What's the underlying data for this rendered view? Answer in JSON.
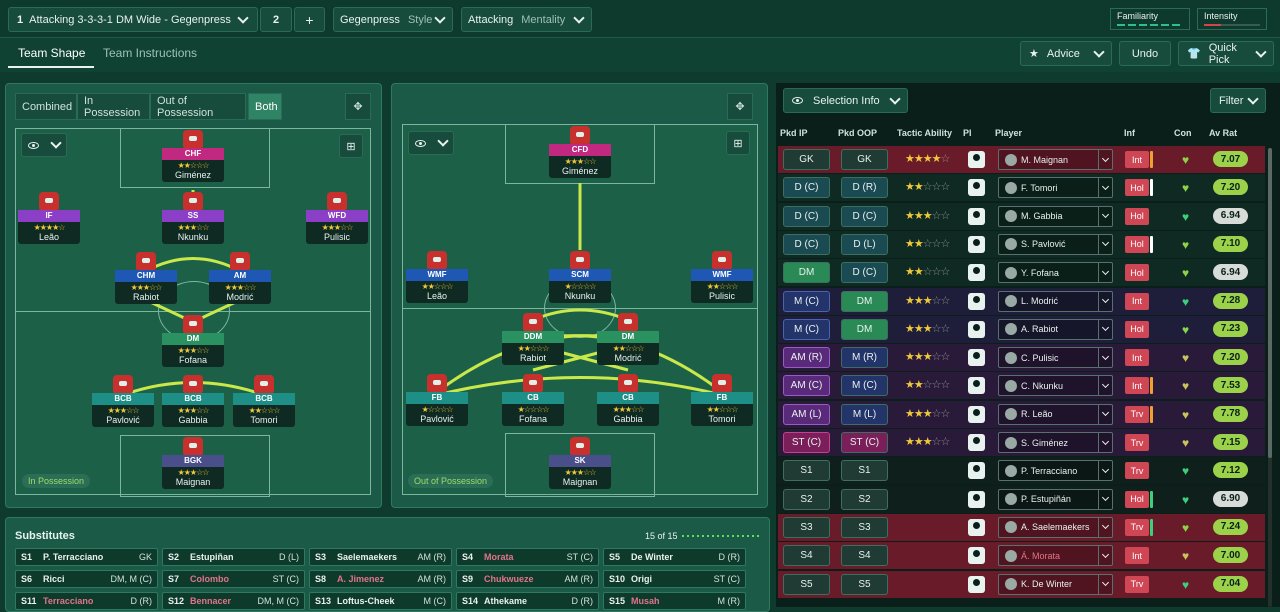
{
  "tactic": {
    "number": "1",
    "name": "Attacking 3-3-3-1 DM Wide - Gegenpress",
    "slot": "2",
    "add": "+",
    "style_value": "Gegenpress",
    "style_label": "Style",
    "mentality_value": "Attacking",
    "mentality_label": "Mentality",
    "familiarity": "Familiarity",
    "intensity": "Intensity"
  },
  "tabs": {
    "team_shape": "Team Shape",
    "team_instructions": "Team Instructions"
  },
  "actions": {
    "advice": "Advice",
    "undo": "Undo",
    "quick_pick": "Quick Pick"
  },
  "views": [
    "Combined",
    "In Possession",
    "Out of Possession",
    "Both"
  ],
  "ip_label": "In Possession",
  "oop_label": "Out of Possession",
  "ip_players": [
    {
      "role": "CHF",
      "name": "Giménez",
      "stars": "★★☆☆☆"
    },
    {
      "role": "IF",
      "name": "Leão",
      "stars": "★★★★☆"
    },
    {
      "role": "SS",
      "name": "Nkunku",
      "stars": "★★★☆☆"
    },
    {
      "role": "WFD",
      "name": "Pulisic",
      "stars": "★★★☆☆"
    },
    {
      "role": "CHM",
      "name": "Rabiot",
      "stars": "★★★☆☆"
    },
    {
      "role": "AM",
      "name": "Modrić",
      "stars": "★★★☆☆"
    },
    {
      "role": "DM",
      "name": "Fofana",
      "stars": "★★★☆☆"
    },
    {
      "role": "BCB",
      "name": "Pavlović",
      "stars": "★★★☆☆"
    },
    {
      "role": "BCB",
      "name": "Gabbia",
      "stars": "★★★☆☆"
    },
    {
      "role": "BCB",
      "name": "Tomori",
      "stars": "★★☆☆☆"
    },
    {
      "role": "BGK",
      "name": "Maignan",
      "stars": "★★★☆☆"
    }
  ],
  "oop_players": [
    {
      "role": "CFD",
      "name": "Giménez",
      "stars": "★★★☆☆"
    },
    {
      "role": "WMF",
      "name": "Leão",
      "stars": "★★☆☆☆"
    },
    {
      "role": "SCM",
      "name": "Nkunku",
      "stars": "★☆☆☆☆"
    },
    {
      "role": "WMF",
      "name": "Pulisic",
      "stars": "★★☆☆☆"
    },
    {
      "role": "DDM",
      "name": "Rabiot",
      "stars": "★★☆☆☆"
    },
    {
      "role": "DM",
      "name": "Modrić",
      "stars": "★★☆☆☆"
    },
    {
      "role": "FB",
      "name": "Pavlović",
      "stars": "★☆☆☆☆"
    },
    {
      "role": "CB",
      "name": "Fofana",
      "stars": "★☆☆☆☆"
    },
    {
      "role": "CB",
      "name": "Gabbia",
      "stars": "★★★☆☆"
    },
    {
      "role": "FB",
      "name": "Tomori",
      "stars": "★★☆☆☆"
    },
    {
      "role": "SK",
      "name": "Maignan",
      "stars": "★★★☆☆"
    }
  ],
  "subs": {
    "title": "Substitutes",
    "count": "15 of 15",
    "rows": [
      [
        {
          "k": "S1",
          "n": "P. Terracciano",
          "p": "GK"
        },
        {
          "k": "S2",
          "n": "Estupiñan",
          "p": "D (L)"
        },
        {
          "k": "S3",
          "n": "Saelemaekers",
          "p": "AM (R)"
        },
        {
          "k": "S4",
          "n": "Morata",
          "p": "ST (C)",
          "red": true
        },
        {
          "k": "S5",
          "n": "De Winter",
          "p": "D (R)"
        }
      ],
      [
        {
          "k": "S6",
          "n": "Ricci",
          "p": "DM, M (C)"
        },
        {
          "k": "S7",
          "n": "Colombo",
          "p": "ST (C)",
          "red": true
        },
        {
          "k": "S8",
          "n": "A. Jimenez",
          "p": "AM (R)",
          "red": true
        },
        {
          "k": "S9",
          "n": "Chukwueze",
          "p": "AM (R)",
          "red": true
        },
        {
          "k": "S10",
          "n": "Origi",
          "p": "ST (C)"
        }
      ],
      [
        {
          "k": "S11",
          "n": "Terracciano",
          "p": "D (R)",
          "red": true
        },
        {
          "k": "S12",
          "n": "Bennacer",
          "p": "DM, M (C)",
          "red": true
        },
        {
          "k": "S13",
          "n": "Loftus-Cheek",
          "p": "M (C)"
        },
        {
          "k": "S14",
          "n": "Athekame",
          "p": "D (R)"
        },
        {
          "k": "S15",
          "n": "Musah",
          "p": "M (R)",
          "red": true
        }
      ]
    ]
  },
  "selection": {
    "label": "Selection Info",
    "filter": "Filter"
  },
  "headers": {
    "ip": "Pkd IP",
    "oop": "Pkd OOP",
    "ta": "Tactic Ability",
    "pi": "PI",
    "player": "Player",
    "inf": "Inf",
    "con": "Con",
    "avrat": "Av Rat"
  },
  "rows": [
    {
      "ip": "GK",
      "oop": "GK",
      "s": 3.5,
      "player": "M. Maignan",
      "inf": "Int",
      "rat": "7.07",
      "infbar": "#f0a030",
      "heart": "#8bd44a",
      "ratc": "#9bd24a"
    },
    {
      "ip": "D (C)",
      "oop": "D (R)",
      "s": 2,
      "player": "F. Tomori",
      "inf": "Hol",
      "rat": "7.20",
      "infbar": "#ffffff",
      "heart": "#8bd44a",
      "ratc": "#9bd24a"
    },
    {
      "ip": "D (C)",
      "oop": "D (C)",
      "s": 3,
      "player": "M. Gabbia",
      "inf": "Hol",
      "rat": "6.94",
      "infbar": "",
      "heart": "#3cd07c",
      "ratc": "#d8dcd8"
    },
    {
      "ip": "D (C)",
      "oop": "D (L)",
      "s": 2,
      "player": "S. Pavlović",
      "inf": "Hol",
      "rat": "7.10",
      "infbar": "#ffffff",
      "heart": "#8bd44a",
      "ratc": "#9bd24a"
    },
    {
      "ip": "DM",
      "oop": "D (C)",
      "s": 2,
      "player": "Y. Fofana",
      "inf": "Hol",
      "rat": "6.94",
      "infbar": "",
      "heart": "#8bd44a",
      "ratc": "#d8dcd8"
    },
    {
      "ip": "M (C)",
      "oop": "DM",
      "s": 3,
      "player": "L. Modrić",
      "inf": "Int",
      "rat": "7.28",
      "infbar": "",
      "heart": "#3cd07c",
      "ratc": "#9bd24a"
    },
    {
      "ip": "M (C)",
      "oop": "DM",
      "s": 3,
      "player": "A. Rabiot",
      "inf": "Hol",
      "rat": "7.23",
      "infbar": "",
      "heart": "#8bd44a",
      "ratc": "#9bd24a"
    },
    {
      "ip": "AM (R)",
      "oop": "M (R)",
      "s": 3,
      "player": "C. Pulisic",
      "inf": "Int",
      "rat": "7.20",
      "infbar": "",
      "heart": "#c9c35a",
      "ratc": "#9bd24a"
    },
    {
      "ip": "AM (C)",
      "oop": "M (C)",
      "s": 2,
      "player": "C. Nkunku",
      "inf": "Int",
      "rat": "7.53",
      "infbar": "#f0a030",
      "heart": "#c9c35a",
      "ratc": "#9bd24a"
    },
    {
      "ip": "AM (L)",
      "oop": "M (L)",
      "s": 3,
      "player": "R. Leão",
      "inf": "Trv",
      "rat": "7.78",
      "infbar": "#f0a030",
      "heart": "#c9c35a",
      "ratc": "#9bd24a"
    },
    {
      "ip": "ST (C)",
      "oop": "ST (C)",
      "s": 3,
      "player": "S. Giménez",
      "inf": "Trv",
      "rat": "7.15",
      "infbar": "",
      "heart": "#c9c35a",
      "ratc": "#9bd24a"
    },
    {
      "ip": "S1",
      "oop": "S1",
      "s": 0,
      "player": "P. Terracciano",
      "inf": "Trv",
      "rat": "7.12",
      "infbar": "",
      "heart": "#3cd07c",
      "ratc": "#9bd24a"
    },
    {
      "ip": "S2",
      "oop": "S2",
      "s": 0,
      "player": "P. Estupiñán",
      "inf": "Hol",
      "rat": "6.90",
      "infbar": "#3cd07c",
      "heart": "#3cd07c",
      "ratc": "#d8dcd8"
    },
    {
      "ip": "S3",
      "oop": "S3",
      "s": 0,
      "player": "A. Saelemaekers",
      "inf": "Trv",
      "rat": "7.24",
      "infbar": "#3cd07c",
      "heart": "#8bd44a",
      "ratc": "#9bd24a"
    },
    {
      "ip": "S4",
      "oop": "S4",
      "s": 0,
      "player": "Á. Morata",
      "inf": "Int",
      "rat": "7.00",
      "infbar": "",
      "heart": "#c9c35a",
      "ratc": "#9bd24a",
      "red": true
    },
    {
      "ip": "S5",
      "oop": "S5",
      "s": 0,
      "player": "K. De Winter",
      "inf": "Trv",
      "rat": "7.04",
      "infbar": "",
      "heart": "#3cd07c",
      "ratc": "#9bd24a"
    }
  ]
}
